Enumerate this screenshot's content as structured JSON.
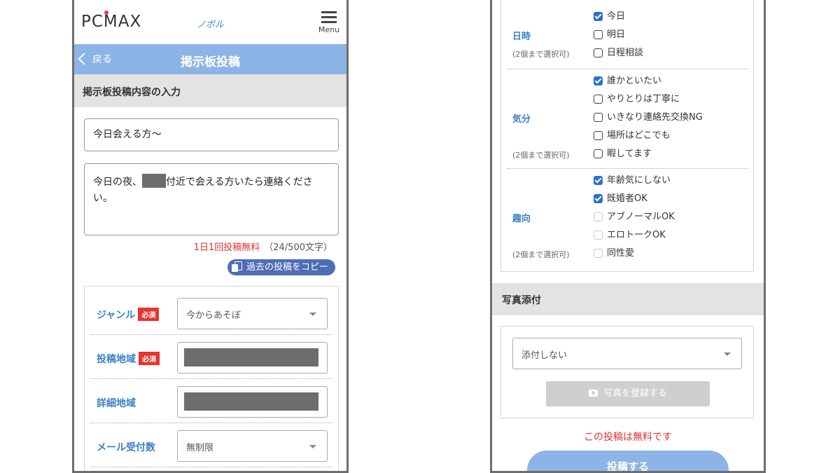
{
  "colors": {
    "header_blue": "#8cb4e6",
    "label_blue": "#3b80c8",
    "required_red": "#e8332f",
    "notice_red": "#e13030",
    "copy_button": "#4f6db5",
    "checkbox_checked": "#2c6fd1"
  },
  "left": {
    "header": {
      "logo": "PCMAX",
      "user_name": "ノボル",
      "menu_label": "Menu"
    },
    "titlebar": {
      "back_label": "戻る",
      "title": "掲示板投稿"
    },
    "section_title": "掲示板投稿内容の入力",
    "post_title": "今日会える方〜",
    "post_body_before": "今日の夜、",
    "post_body_after": "付近で会える方いたら連絡ください。",
    "free_note": "1日1回投稿無料",
    "char_count": "（24/500文字）",
    "copy_button": "過去の投稿をコピー",
    "fields": {
      "genre": {
        "label": "ジャンル",
        "badge": "必須",
        "value": "今からあそぼ"
      },
      "region": {
        "label": "投稿地域",
        "badge": "必須"
      },
      "detail_region": {
        "label": "詳細地域"
      },
      "mail_limit": {
        "label": "メール受付数",
        "value": "無制限"
      }
    }
  },
  "right": {
    "datetime": {
      "label": "日時",
      "note": "(2個まで選択可)",
      "options": [
        {
          "label": "今日",
          "checked": true
        },
        {
          "label": "明日",
          "checked": false
        },
        {
          "label": "日程相談",
          "checked": false
        }
      ]
    },
    "mood": {
      "label": "気分",
      "note": "(2個まで選択可)",
      "options": [
        {
          "label": "誰かといたい",
          "checked": true
        },
        {
          "label": "やりとりは丁寧に",
          "checked": false
        },
        {
          "label": "いきなり連絡先交換NG",
          "checked": false
        },
        {
          "label": "場所はどこでも",
          "checked": false
        },
        {
          "label": "暇してます",
          "checked": false
        }
      ]
    },
    "preference": {
      "label": "趣向",
      "note": "(2個まで選択可)",
      "options": [
        {
          "label": "年齢気にしない",
          "checked": true
        },
        {
          "label": "既婚者OK",
          "checked": true
        },
        {
          "label": "アブノーマルOK",
          "checked": false
        },
        {
          "label": "エロトークOK",
          "checked": false
        },
        {
          "label": "同性愛",
          "checked": false
        }
      ]
    },
    "photo_section_title": "写真添付",
    "attach_select_value": "添付しない",
    "register_photo_button": "写真を登録する",
    "free_notice": "この投稿は無料です",
    "submit_button": "投稿する"
  }
}
